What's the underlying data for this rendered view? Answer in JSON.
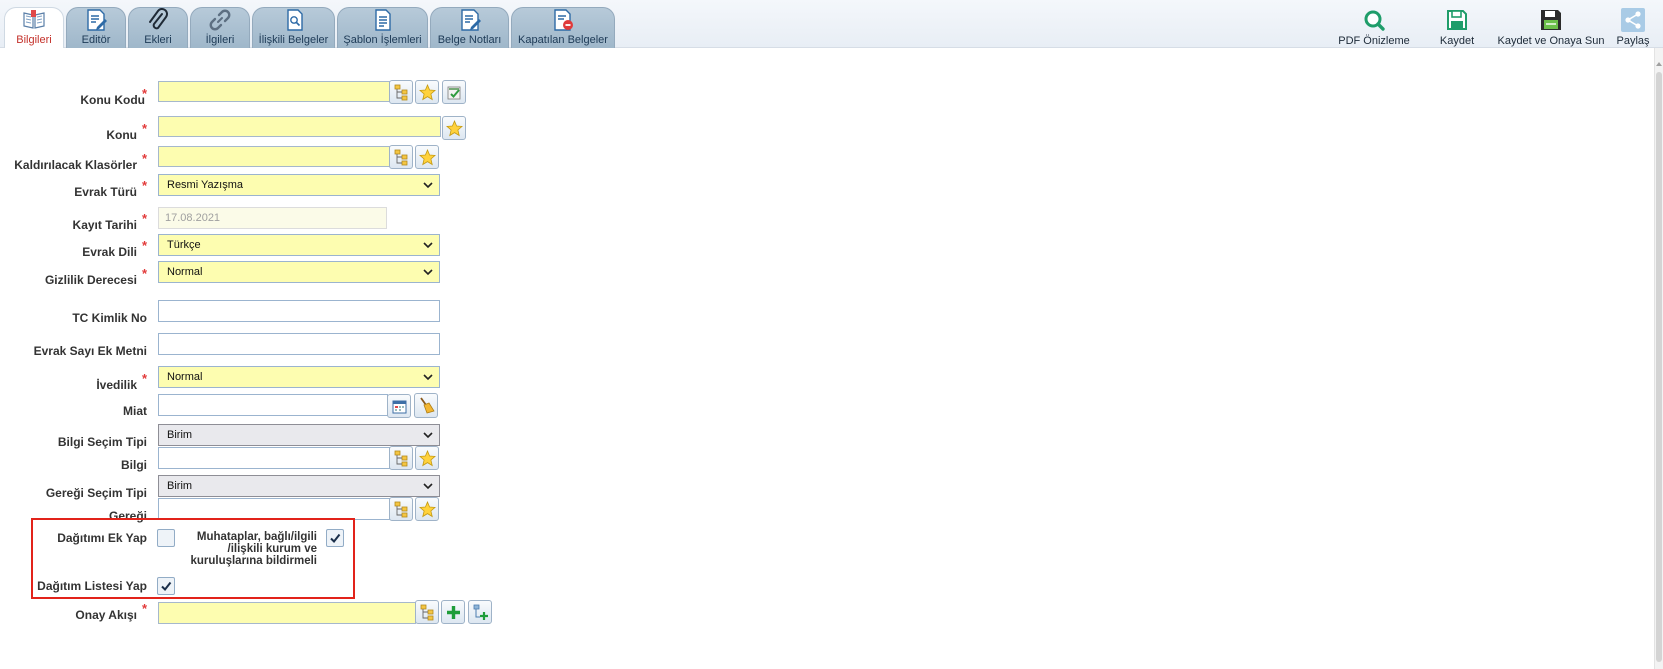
{
  "tabs": [
    {
      "label": "Bilgileri",
      "icon": "book-icon",
      "active": true
    },
    {
      "label": "Editör",
      "icon": "edit-document-icon",
      "active": false
    },
    {
      "label": "Ekleri",
      "icon": "paperclip-icon",
      "active": false
    },
    {
      "label": "İlgileri",
      "icon": "link-icon",
      "active": false
    },
    {
      "label": "İlişkili Belgeler",
      "icon": "related-documents-icon",
      "active": false
    },
    {
      "label": "Şablon İşlemleri",
      "icon": "template-document-icon",
      "active": false
    },
    {
      "label": "Belge Notları",
      "icon": "document-notes-icon",
      "active": false
    },
    {
      "label": "Kapatılan Belgeler",
      "icon": "closed-documents-icon",
      "active": false
    }
  ],
  "actions": {
    "pdf_preview": "PDF Önizleme",
    "save": "Kaydet",
    "save_and_submit": "Kaydet ve Onaya Sun",
    "share": "Paylaş"
  },
  "form": {
    "konu_kodu": {
      "label": "Konu Kodu",
      "required": "*",
      "value": ""
    },
    "konu": {
      "label": "Konu",
      "required": "*",
      "value": ""
    },
    "kaldirilacak_klasorler": {
      "label": "Kaldırılacak Klasörler",
      "required": "*",
      "value": ""
    },
    "evrak_turu": {
      "label": "Evrak Türü",
      "required": "*",
      "value": "Resmi Yazışma"
    },
    "kayit_tarihi": {
      "label": "Kayıt Tarihi",
      "required": "*",
      "value": "17.08.2021"
    },
    "evrak_dili": {
      "label": "Evrak Dili",
      "required": "*",
      "value": "Türkçe"
    },
    "gizlilik_derecesi": {
      "label": "Gizlilik Derecesi",
      "required": "*",
      "value": "Normal"
    },
    "tc_kimlik_no": {
      "label": "TC Kimlik No",
      "value": ""
    },
    "evrak_sayi_ek_metni": {
      "label": "Evrak Sayı Ek Metni",
      "value": ""
    },
    "ivedilik": {
      "label": "İvedilik",
      "required": "*",
      "value": "Normal"
    },
    "miat": {
      "label": "Miat",
      "value": ""
    },
    "bilgi_secim_tipi": {
      "label": "Bilgi Seçim Tipi",
      "value": "Birim"
    },
    "bilgi": {
      "label": "Bilgi",
      "value": ""
    },
    "geregi_secim_tipi": {
      "label": "Gereği Seçim Tipi",
      "value": "Birim"
    },
    "geregi": {
      "label": "Gereği",
      "value": ""
    },
    "dagitimi_ek_yap": {
      "label": "Dağıtımı Ek Yap",
      "checked": false
    },
    "muhataplar": {
      "line1": "Muhataplar, bağlı/ilgili",
      "line2": "/ilişkili kurum ve",
      "line3": "kuruluşlarına bildirmeli",
      "checked": true
    },
    "dagitim_listesi_yap": {
      "label": "Dağıtım Listesi Yap",
      "checked": true
    },
    "onay_akisi": {
      "label": "Onay Akışı",
      "required": "*",
      "value": ""
    }
  },
  "colors": {
    "required": "#e23a3a",
    "field_yellow": "#fdfdb0",
    "highlight_border": "#e2231a",
    "tab_active_label": "#c4312b"
  }
}
